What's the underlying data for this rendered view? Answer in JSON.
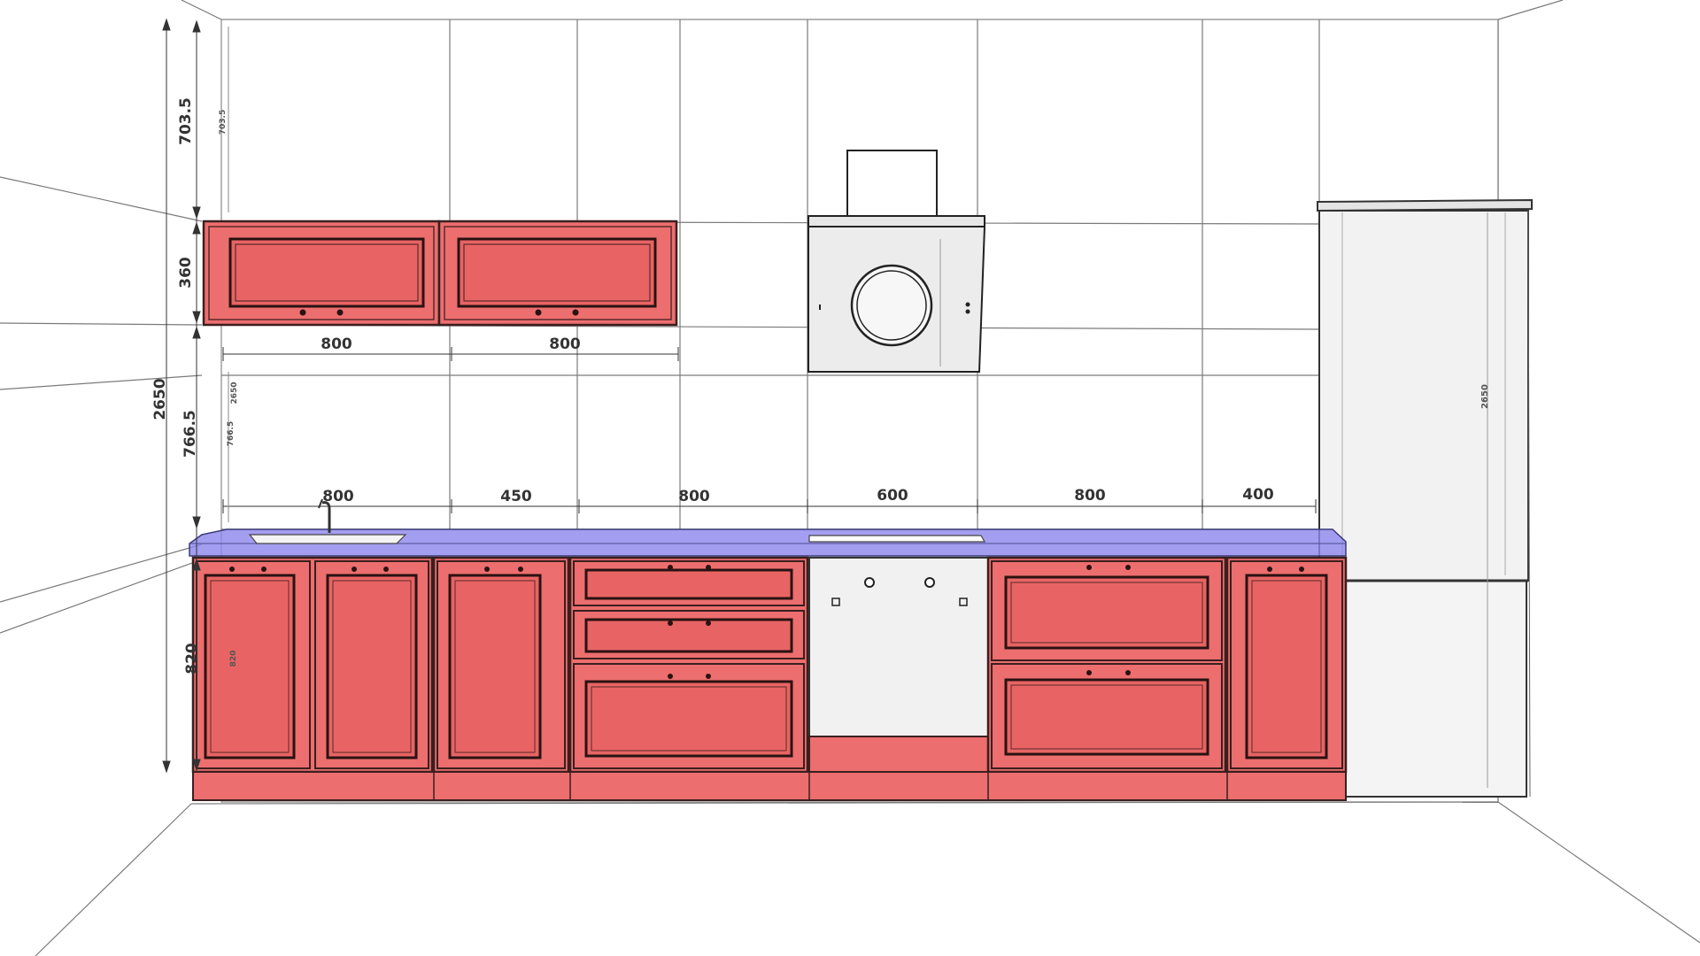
{
  "colors": {
    "cabinet_fill": "#ec6e6e",
    "cabinet_stroke": "#3a1f1f",
    "countertop": "#8d86ee",
    "appliance": "#ececec",
    "wall_line": "#777777",
    "dimension": "#333333"
  },
  "dimensions": {
    "upper_widths": [
      "800",
      "800"
    ],
    "base_widths": [
      "800",
      "450",
      "800",
      "600",
      "800",
      "400"
    ],
    "vertical": {
      "total_height": "2650",
      "top_gap": "703.5",
      "upper_height": "360",
      "mid_gap": "766.5",
      "base_height": "820"
    },
    "faint_labels": {
      "top_gap_small": "703.5",
      "mid_gap_small": "766.5",
      "total_small": "2650",
      "base_small": "820",
      "fridge_height": "2650"
    }
  },
  "components": {
    "upper_cabinets": [
      "upper-cabinet-left",
      "upper-cabinet-right"
    ],
    "base_modules": [
      "sink-base-double-door",
      "base-single-door",
      "drawer-unit-three",
      "built-in-oven",
      "drawer-unit-two",
      "base-narrow-door"
    ],
    "appliances": [
      "range-hood",
      "cooktop",
      "oven",
      "refrigerator",
      "sink",
      "faucet"
    ]
  }
}
